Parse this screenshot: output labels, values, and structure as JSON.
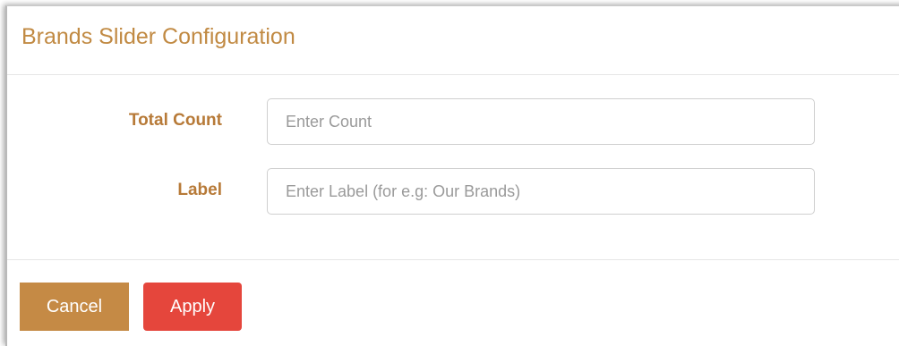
{
  "dialog": {
    "title": "Brands Slider Configuration"
  },
  "form": {
    "total_count": {
      "label": "Total Count",
      "value": "",
      "placeholder": "Enter Count"
    },
    "label": {
      "label": "Label",
      "value": "",
      "placeholder": "Enter Label (for e.g: Our Brands)"
    }
  },
  "footer": {
    "cancel_label": "Cancel",
    "apply_label": "Apply"
  },
  "colors": {
    "title_accent": "#c18a43",
    "label_accent": "#b77a38",
    "cancel_button": "#c58a45",
    "apply_button": "#e5463c"
  }
}
